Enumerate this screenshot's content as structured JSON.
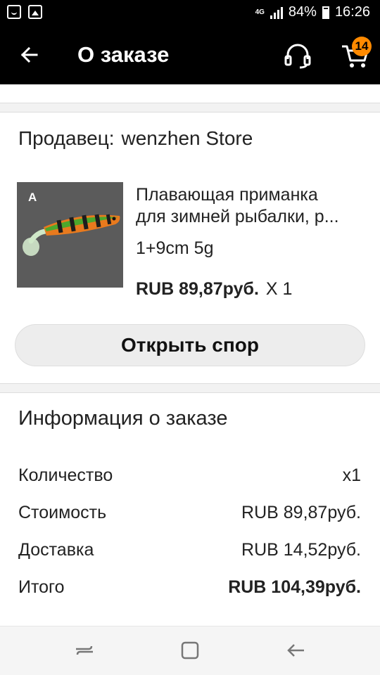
{
  "status_bar": {
    "network": "4G",
    "battery": "84%",
    "time": "16:26"
  },
  "app_bar": {
    "title": "О заказе",
    "back_icon": "arrow-back-icon",
    "support_icon": "headset-icon",
    "cart_icon": "cart-icon",
    "cart_count": "14",
    "cart_badge_color": "#ff8a00"
  },
  "seller": {
    "label": "Продавец:",
    "name": "wenzhen Store"
  },
  "product": {
    "image_letter": "A",
    "title_line1": "Плавающая приманка",
    "title_line2": "для зимней рыбалки, р...",
    "variant": "1+9cm 5g",
    "price": "RUB 89,87руб.",
    "quantity": "X 1"
  },
  "dispute_button": {
    "label": "Открыть спор"
  },
  "order_info": {
    "title": "Информация о заказе",
    "rows": [
      {
        "label": "Количество",
        "value": "x1"
      },
      {
        "label": "Стоимость",
        "value": "RUB 89,87руб."
      },
      {
        "label": "Доставка",
        "value": "RUB 14,52руб."
      },
      {
        "label": "Итого",
        "value": "RUB 104,39руб."
      }
    ]
  },
  "nav_bar": {
    "icons": [
      "recent-apps-icon",
      "home-icon",
      "back-icon"
    ]
  }
}
